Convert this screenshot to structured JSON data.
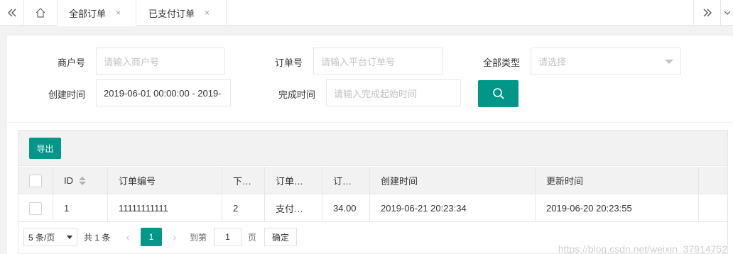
{
  "tabbar": {
    "prev_icon": "double-chevron-left-icon",
    "home_icon": "home-icon",
    "tabs": [
      {
        "label": "全部订单",
        "close": "×"
      },
      {
        "label": "已支付订单",
        "close": "×"
      }
    ],
    "next_icon": "double-chevron-right-icon",
    "more_icon": "chevron-down-icon"
  },
  "filters": {
    "merchant": {
      "label": "商户号",
      "placeholder": "请输入商户号"
    },
    "order_no": {
      "label": "订单号",
      "placeholder": "请输入平台订单号"
    },
    "type": {
      "label": "全部类型",
      "placeholder": "请选择"
    },
    "created": {
      "label": "创建时间",
      "value": "2019-06-01 00:00:00 - 2019-"
    },
    "completed": {
      "label": "完成时间",
      "placeholder": "请输入完成起始时间"
    },
    "search_icon": "search-icon"
  },
  "toolbar": {
    "export_label": "导出"
  },
  "table": {
    "headers": [
      "ID",
      "订单编号",
      "下…",
      "订单…",
      "订…",
      "创建时间",
      "更新时间"
    ],
    "rows": [
      {
        "id": "1",
        "order_no": "11111111111",
        "c3": "2",
        "status": "支付…",
        "amount": "34.00",
        "created": "2019-06-21 20:23:34",
        "updated": "2019-06-20 20:23:55"
      }
    ]
  },
  "pager": {
    "limit": "5 条/页",
    "count": "共 1 条",
    "prev": "‹",
    "current": "1",
    "next": "›",
    "goto_label": "到第",
    "goto_value": "1",
    "page_label": "页",
    "ok": "确定"
  },
  "watermark": "https://blog.csdn.net/weixin_37914752",
  "colors": {
    "accent": "#009688"
  }
}
